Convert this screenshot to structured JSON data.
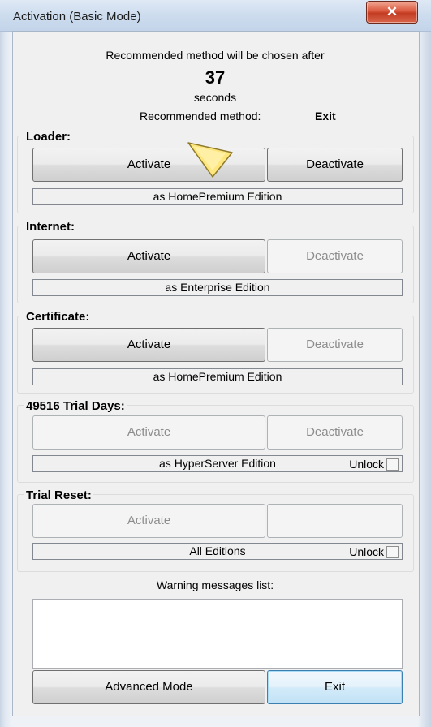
{
  "window": {
    "title": "Activation (Basic Mode)",
    "close_glyph": "✕"
  },
  "countdown": {
    "intro": "Recommended method will be chosen after",
    "value": "37",
    "unit": "seconds",
    "method_label": "Recommended method:",
    "method_value": "Exit"
  },
  "groups": {
    "loader": {
      "label": "Loader:",
      "activate": "Activate",
      "deactivate": "Deactivate",
      "edition": "as HomePremium Edition"
    },
    "internet": {
      "label": "Internet:",
      "activate": "Activate",
      "deactivate": "Deactivate",
      "edition": "as Enterprise Edition"
    },
    "certificate": {
      "label": "Certificate:",
      "activate": "Activate",
      "deactivate": "Deactivate",
      "edition": "as HomePremium Edition"
    },
    "trial_days": {
      "label": "49516 Trial Days:",
      "activate": "Activate",
      "deactivate": "Deactivate",
      "edition": "as HyperServer Edition",
      "unlock": "Unlock"
    },
    "trial_reset": {
      "label": "Trial Reset:",
      "activate": "Activate",
      "deactivate": "",
      "edition": "All Editions",
      "unlock": "Unlock"
    }
  },
  "warnings": {
    "label": "Warning messages list:"
  },
  "footer": {
    "advanced": "Advanced Mode",
    "exit": "Exit"
  },
  "colors": {
    "close_button": "#c94a2f",
    "focus_border": "#3c7fb1",
    "cursor_fill": "#fde67c"
  },
  "icons": {
    "close": "close-icon",
    "cursor": "mouse-cursor-icon"
  }
}
